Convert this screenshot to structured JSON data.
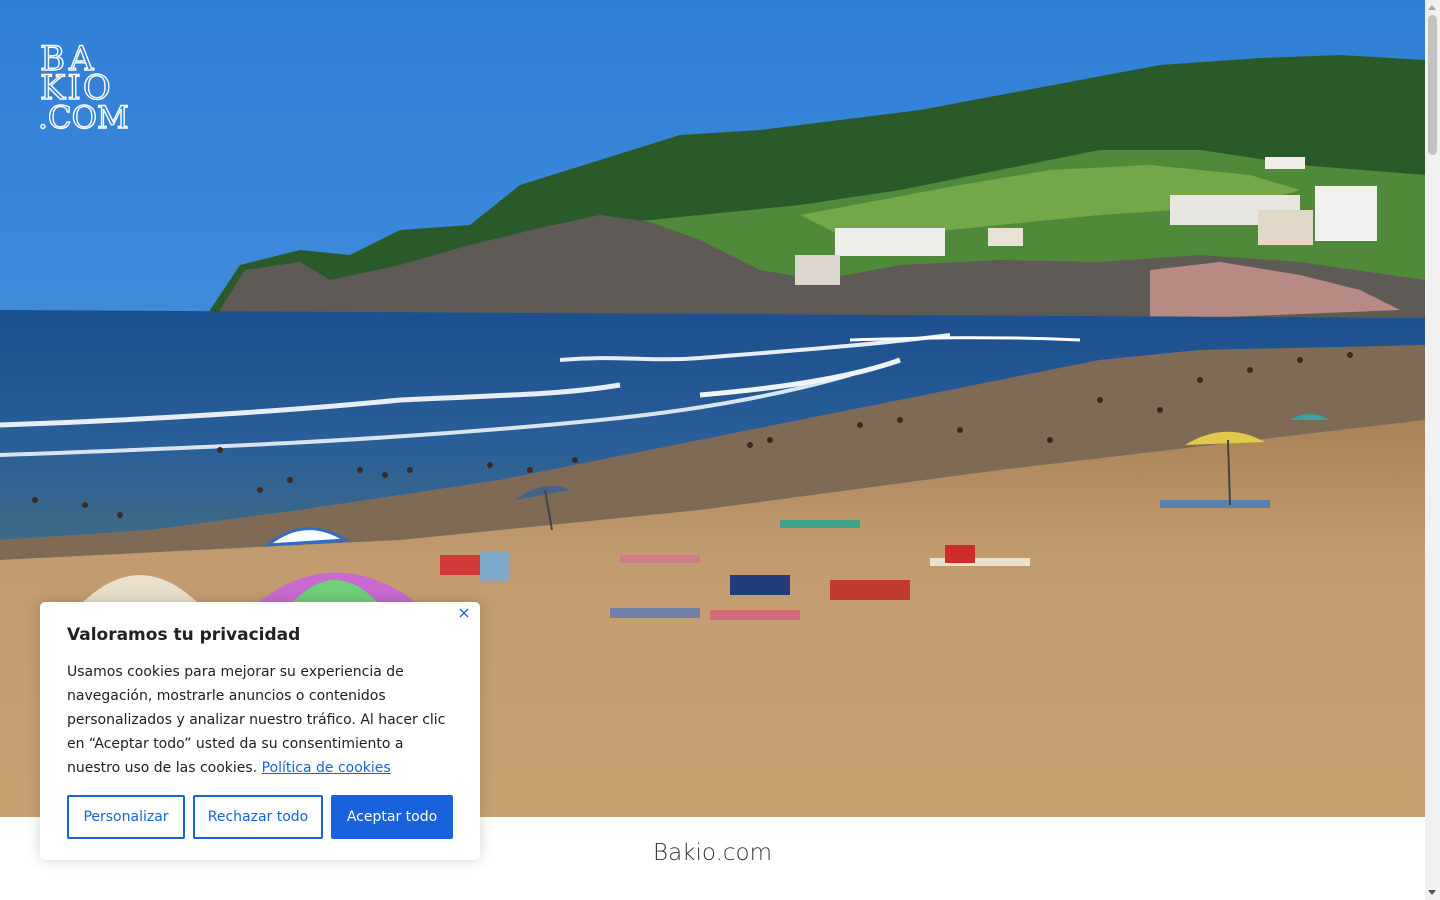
{
  "site": {
    "logo_lines": [
      "BA",
      "KIO",
      ".COM"
    ],
    "page_title": "Bakio.com"
  },
  "hero": {
    "image_description_icon": "beach-photo"
  },
  "cookie_banner": {
    "title": "Valoramos tu privacidad",
    "message": "Usamos cookies para mejorar su experiencia de navegación, mostrarle anuncios o contenidos personalizados y analizar nuestro tráfico. Al hacer clic en “Aceptar todo” usted da su consentimiento a nuestro uso de las cookies.",
    "policy_link": "Política de cookies",
    "buttons": {
      "customize": "Personalizar",
      "reject": "Rechazar todo",
      "accept": "Aceptar todo"
    },
    "close_icon": "close-icon"
  },
  "colors": {
    "accent": "#1863dc",
    "sky": "#3d86d8",
    "sea": "#1f4f8a",
    "sand": "#c49a6c"
  }
}
